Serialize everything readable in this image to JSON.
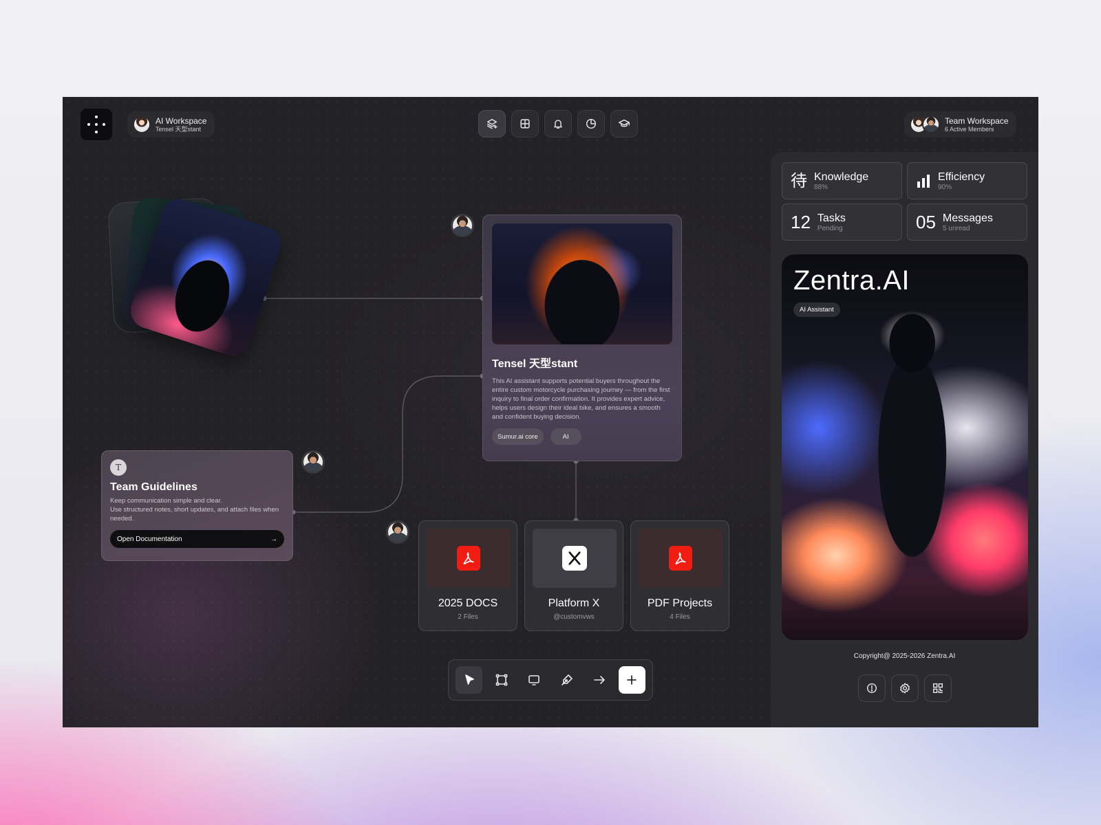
{
  "header": {
    "workspace": {
      "title": "AI Workspace",
      "subtitle": "Tensel 天型stant"
    },
    "team": {
      "title": "Team Workspace",
      "subtitle": "6 Active Members"
    },
    "top_tools": [
      "layers-icon",
      "grid-icon",
      "bell-icon",
      "pie-chart-icon",
      "graduation-cap-icon"
    ]
  },
  "assistant_card": {
    "title": "Tensel 天型stant",
    "description": "This AI assistant supports potential buyers throughout the entire custom motorcycle purchasing journey — from the first inquiry to final order confirmation. It provides expert advice, helps users design their ideal bike, and ensures a smooth and confident buying decision.",
    "tags": [
      "Sumur.ai core",
      "AI"
    ]
  },
  "guidelines_card": {
    "icon_letter": "T",
    "title": "Team Guidelines",
    "lines": [
      "Keep communication simple and clear.",
      "Use structured notes, short updates, and attach files when needed."
    ],
    "button": "Open Documentation",
    "button_arrow": "→"
  },
  "files": [
    {
      "name": "2025 DOCS",
      "sub": "2 Files",
      "icon": "pdf-icon"
    },
    {
      "name": "Platform X",
      "sub": "@customvws",
      "icon": "x-logo-icon"
    },
    {
      "name": "PDF Projects",
      "sub": "4 Files",
      "icon": "pdf-icon"
    }
  ],
  "toolbar": {
    "tools": [
      "pointer-icon",
      "frame-icon",
      "screen-icon",
      "pen-icon",
      "arrow-icon",
      "plus-icon"
    ],
    "selected": "pointer-icon"
  },
  "stats": [
    {
      "big": "待",
      "label": "Knowledge",
      "sub": "88%"
    },
    {
      "big": "",
      "label": "Efficiency",
      "sub": "90%",
      "icon": "bar-chart-icon"
    },
    {
      "big": "12",
      "label": "Tasks",
      "sub": "Pending"
    },
    {
      "big": "05",
      "label": "Messages",
      "sub": "5 unread"
    }
  ],
  "hero": {
    "title": "Zentra.AI",
    "badge": "AI Assistant"
  },
  "footer": {
    "copyright": "Copyright@ 2025-2026 Zentra.AI",
    "buttons": [
      "info-icon",
      "settings-icon",
      "qr-code-icon"
    ]
  }
}
